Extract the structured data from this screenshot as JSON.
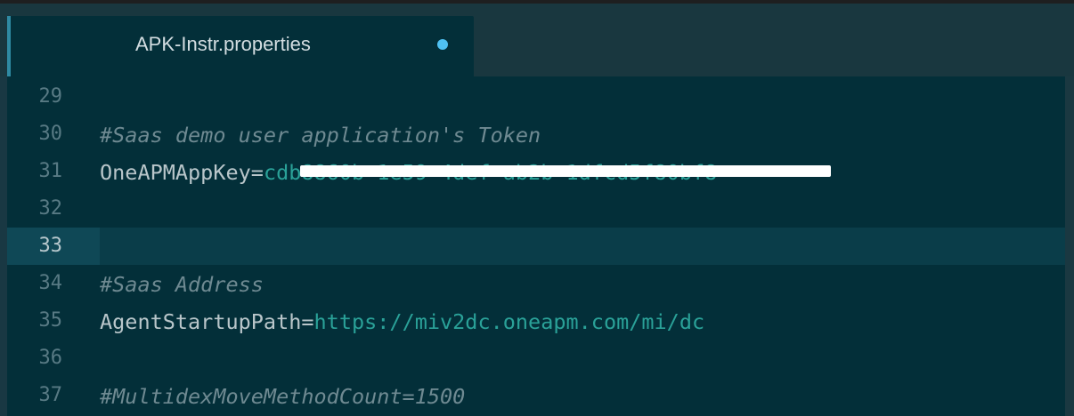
{
  "window": {
    "tab": {
      "title": "APK-Instr.properties",
      "modified_indicator_color": "#4fc1f2"
    }
  },
  "editor": {
    "current_line": "33",
    "lines": [
      {
        "number": "29",
        "comment": "",
        "key": "",
        "value": ""
      },
      {
        "number": "30",
        "comment": "#Saas demo user application's Token",
        "key": "",
        "value": ""
      },
      {
        "number": "31",
        "comment": "",
        "key": "OneAPMAppKey=",
        "value": "cdb8860b-1e59-4def-ab2b-1dfcd5f80bf8"
      },
      {
        "number": "32",
        "comment": "",
        "key": "",
        "value": ""
      },
      {
        "number": "33",
        "comment": "",
        "key": "",
        "value": ""
      },
      {
        "number": "34",
        "comment": "#Saas Address",
        "key": "",
        "value": ""
      },
      {
        "number": "35",
        "comment": "",
        "key": "AgentStartupPath=",
        "value": "https://miv2dc.oneapm.com/mi/dc"
      },
      {
        "number": "36",
        "comment": "",
        "key": "",
        "value": ""
      },
      {
        "number": "37",
        "comment": "#MultidexMoveMethodCount=1500",
        "key": "",
        "value": ""
      }
    ]
  },
  "colors": {
    "editor_background": "#032f39",
    "comment": "#6f8a92",
    "key": "#b9c6ca",
    "value": "#2aa198",
    "current_line": "#0a3d49"
  }
}
